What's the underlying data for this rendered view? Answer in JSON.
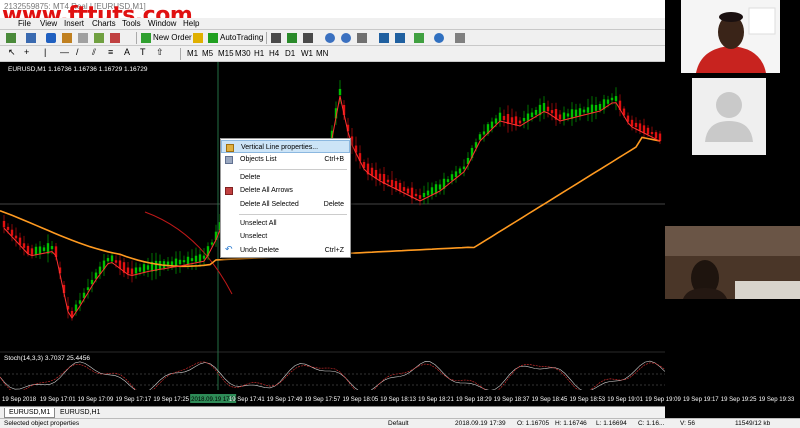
{
  "window": {
    "title": "2132559875: MT4 Real | [EURUSD,M1]",
    "watermark": "www.fttuts.com"
  },
  "menu": {
    "items": [
      "File",
      "View",
      "Insert",
      "Charts",
      "Tools",
      "Window",
      "Help"
    ]
  },
  "toolbar": {
    "new_order": "New Order",
    "autotrading": "AutoTrading",
    "timeframes": [
      "M1",
      "M5",
      "M15",
      "M30",
      "H1",
      "H4",
      "D1",
      "W1",
      "MN"
    ]
  },
  "chart": {
    "symbol_header": "EURUSD,M1  1.16736 1.16736 1.16729 1.16729",
    "stoch_label": "Stoch(14,3,3) 3.7037 25.4456",
    "time_labels": [
      "19 Sep 2018",
      "19 Sep 17:01",
      "19 Sep 17:09",
      "19 Sep 17:17",
      "19 Sep 17:25",
      "2018.09.19 17:39",
      "19 Sep 17:41",
      "19 Sep 17:49",
      "19 Sep 17:57",
      "19 Sep 18:05",
      "19 Sep 18:13",
      "19 Sep 18:21",
      "19 Sep 18:29",
      "19 Sep 18:37",
      "19 Sep 18:45",
      "19 Sep 18:53",
      "19 Sep 19:01",
      "19 Sep 19:09",
      "19 Sep 19:17",
      "19 Sep 19:25",
      "19 Sep 19:33"
    ],
    "colors": {
      "bull": "#00c000",
      "bear": "#e01010",
      "ma_fast": "#ff3030",
      "ma_slow": "#ff9a20",
      "vline": "#2e8b57"
    }
  },
  "context_menu": {
    "items": [
      {
        "label": "Vertical Line properties...",
        "shortcut": "",
        "icon": "properties-icon"
      },
      {
        "label": "Objects List",
        "shortcut": "Ctrl+B",
        "icon": "list-icon"
      },
      {
        "label": "Delete",
        "shortcut": "",
        "icon": ""
      },
      {
        "label": "Delete All Arrows",
        "shortcut": "",
        "icon": "delete-arrows-icon"
      },
      {
        "label": "Delete All Selected",
        "shortcut": "Delete",
        "icon": ""
      },
      {
        "label": "Unselect All",
        "shortcut": "",
        "icon": ""
      },
      {
        "label": "Unselect",
        "shortcut": "",
        "icon": ""
      },
      {
        "label": "Undo Delete",
        "shortcut": "Ctrl+Z",
        "icon": "undo-icon"
      }
    ]
  },
  "tabs": [
    "EURUSD,M1",
    "EURUSD,H1"
  ],
  "status": {
    "left": "Selected object properties",
    "profile": "Default",
    "datetime": "2018.09.19 17:39",
    "open": "O: 1.16705",
    "high": "H: 1.16746",
    "low": "L: 1.16694",
    "close": "C: 1.16...",
    "volume": "V: 56",
    "traffic": "11549/12 kb"
  }
}
